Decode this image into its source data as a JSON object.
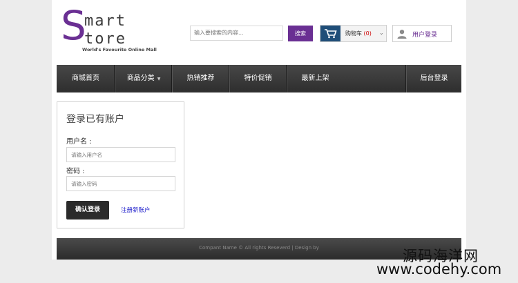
{
  "logo": {
    "initial": "S",
    "line1": "mart",
    "line2": "tore",
    "tagline": "World's Favourite Online Mall"
  },
  "search": {
    "placeholder": "输入要搜索的内容...",
    "button_label": "搜索"
  },
  "cart": {
    "icon": "cart-icon",
    "label": "购物车",
    "count": "(0)",
    "caret": "⌄"
  },
  "user_login": {
    "icon": "user-icon",
    "label": "用户登录"
  },
  "nav": {
    "items": [
      {
        "label": "商城首页"
      },
      {
        "label": "商品分类",
        "has_caret": true
      },
      {
        "label": "热销推荐"
      },
      {
        "label": "特价促销"
      },
      {
        "label": "最新上架"
      },
      {
        "label": "后台登录"
      }
    ],
    "caret": "▼"
  },
  "login_panel": {
    "title": "登录已有账户",
    "username_label": "用户名 :",
    "username_placeholder": "请输入用户名",
    "password_label": "密码 :",
    "password_placeholder": "请输入密码",
    "submit_label": "确认登录",
    "register_label": "注册新账户"
  },
  "footer": {
    "text": "Compant Name © All rights Reseverd | Design by"
  },
  "watermark": {
    "chinese": "源码海洋网",
    "url": "www.codehy.com"
  },
  "colors": {
    "brand_purple": "#6a2f93",
    "nav_dark": "#3a3a3a",
    "cart_blue": "#1f4e78",
    "link_blue": "#2222cc"
  }
}
